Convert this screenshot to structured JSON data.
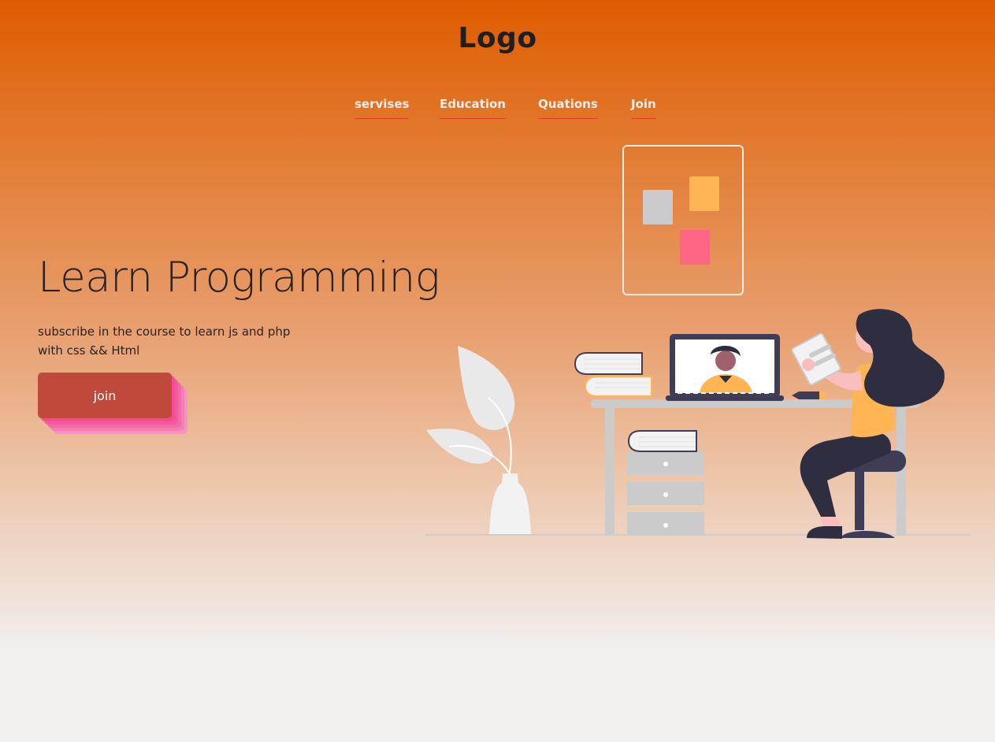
{
  "header": {
    "logo": "Logo"
  },
  "nav": {
    "items": [
      {
        "label": "servises"
      },
      {
        "label": "Education"
      },
      {
        "label": "Quations"
      },
      {
        "label": "Join"
      }
    ]
  },
  "hero": {
    "title": "Learn Programming",
    "subtitle": "subscribe in the course to learn js and php with css && Html",
    "cta_label": "join"
  },
  "colors": {
    "background_top": "#e05c00",
    "background_bottom": "#f1f0ef",
    "cta_button": "#bf4a3b",
    "cta_shadow": "#f54b96",
    "nav_underline": "#e0402a"
  },
  "illustration": {
    "name": "woman-studying-at-desk-illustration"
  }
}
